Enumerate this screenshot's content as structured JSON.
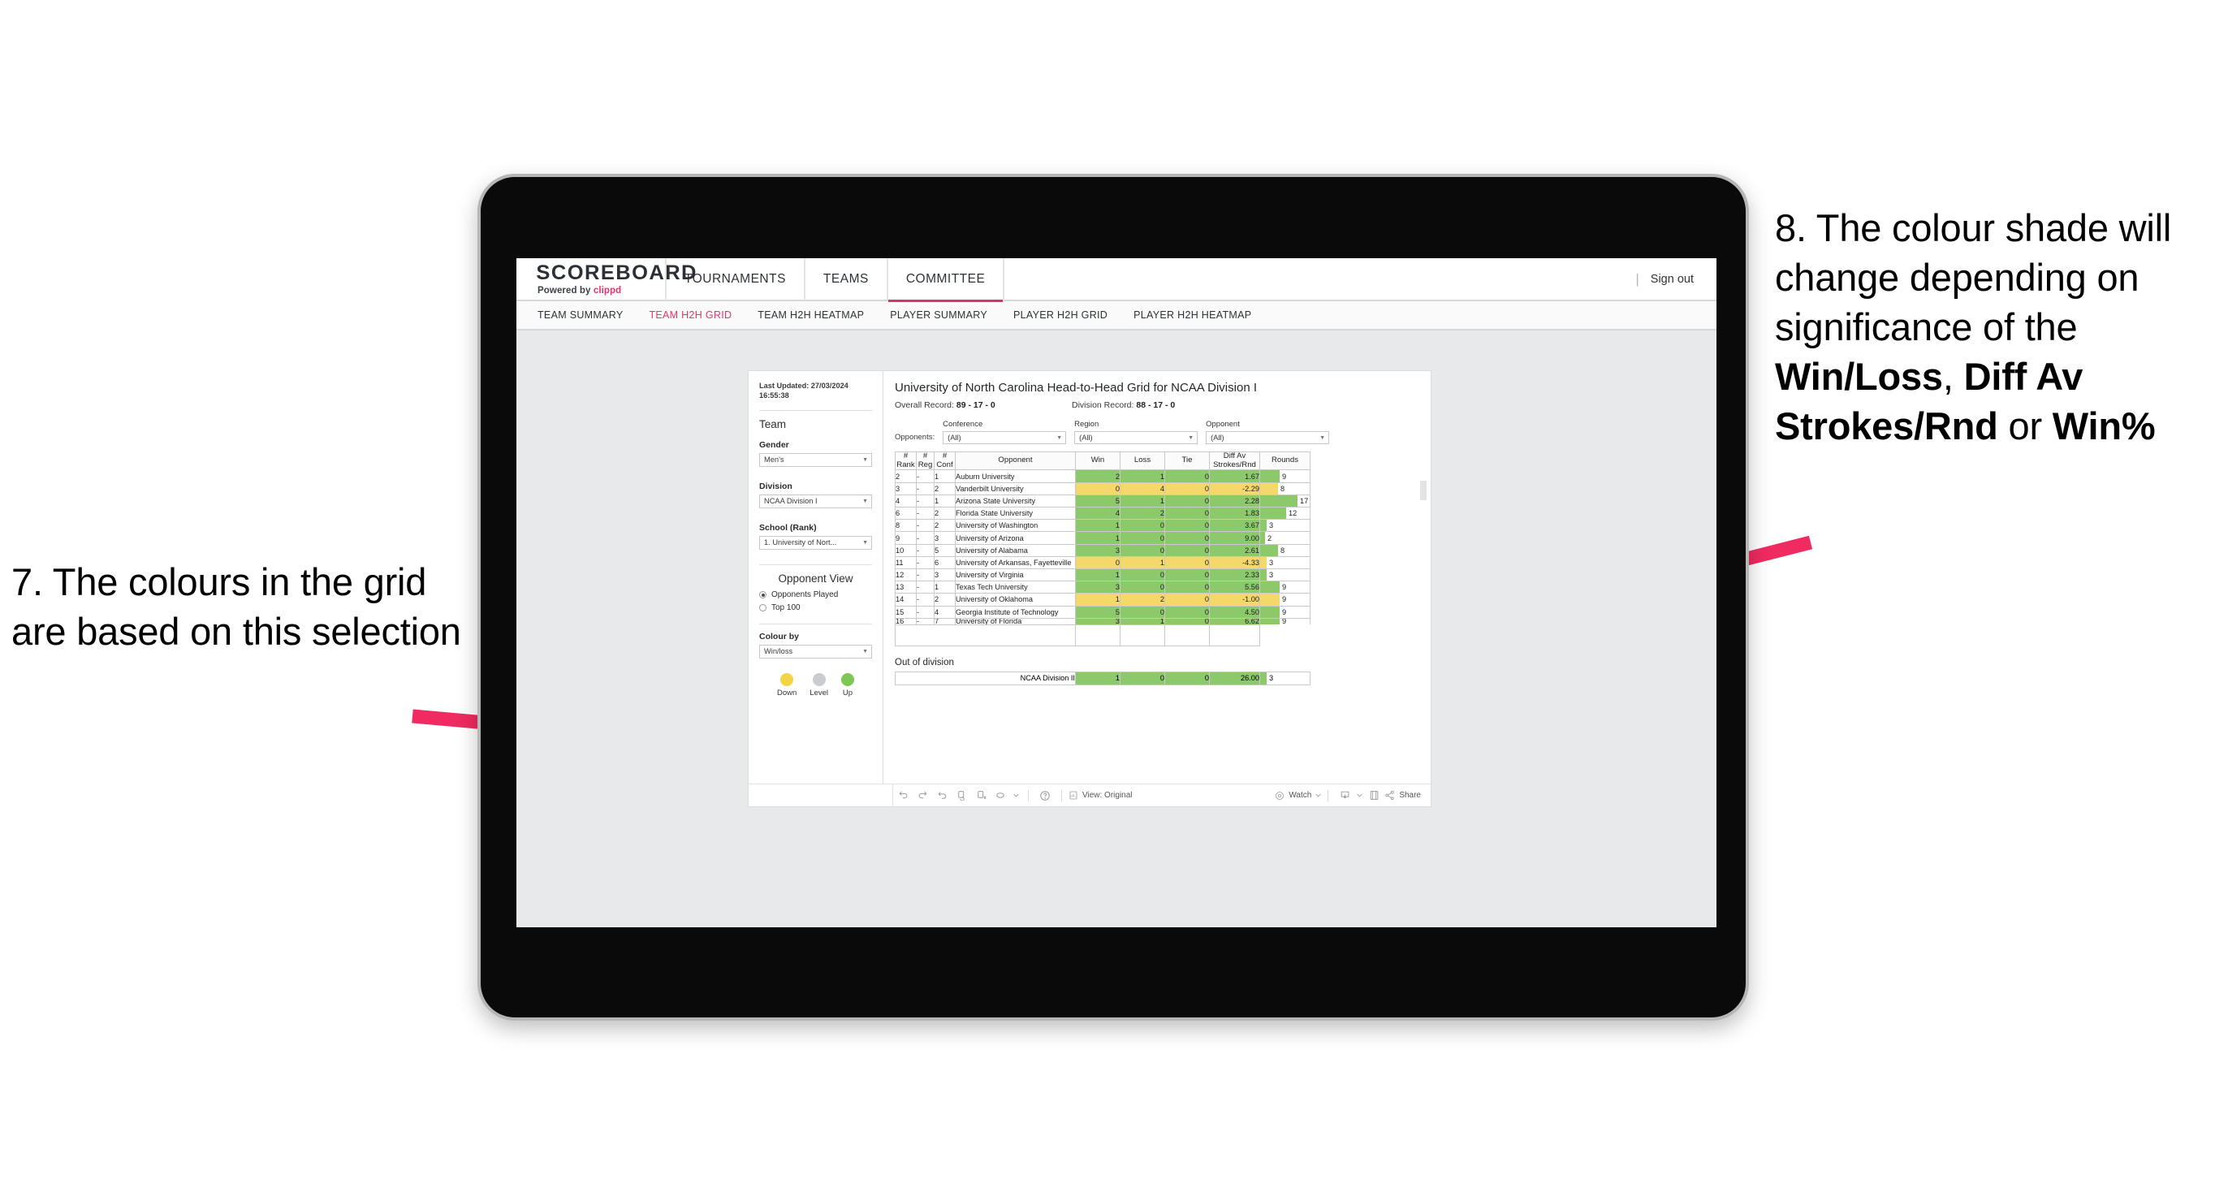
{
  "annotations": {
    "left": {
      "id": "annotation-7",
      "text": "7. The colours in the grid are based on this selection"
    },
    "right": {
      "id": "annotation-8",
      "lead": "8. The colour shade will change depending on significance of the ",
      "bold1": "Win/Loss",
      "mid1": ", ",
      "bold2": "Diff Av Strokes/Rnd",
      "mid2": " or ",
      "bold3": "Win%"
    },
    "arrow_color": "#ef2b61"
  },
  "app": {
    "brand": {
      "title": "SCOREBOARD",
      "powered_prefix": "Powered by ",
      "powered_brand": "clippd"
    },
    "nav": [
      {
        "label": "TOURNAMENTS",
        "active": false
      },
      {
        "label": "TEAMS",
        "active": false
      },
      {
        "label": "COMMITTEE",
        "active": true
      }
    ],
    "nav_divider": "|",
    "sign_out": "Sign out",
    "subnav": [
      {
        "label": "TEAM SUMMARY",
        "active": false
      },
      {
        "label": "TEAM H2H GRID",
        "active": true
      },
      {
        "label": "TEAM H2H HEATMAP",
        "active": false
      },
      {
        "label": "PLAYER SUMMARY",
        "active": false
      },
      {
        "label": "PLAYER H2H GRID",
        "active": false
      },
      {
        "label": "PLAYER H2H HEATMAP",
        "active": false
      }
    ],
    "accent_color": "#e8336a"
  },
  "filters": {
    "last_updated": "Last Updated: 27/03/2024 16:55:38",
    "team_heading": "Team",
    "gender": {
      "label": "Gender",
      "value": "Men's"
    },
    "division": {
      "label": "Division",
      "value": "NCAA Division I"
    },
    "school": {
      "label": "School (Rank)",
      "value": "1. University of Nort..."
    },
    "opponent_view": {
      "heading": "Opponent View",
      "options": [
        {
          "label": "Opponents Played",
          "selected": true
        },
        {
          "label": "Top 100",
          "selected": false
        }
      ]
    },
    "colour_by": {
      "label": "Colour by",
      "value": "Win/loss"
    },
    "legend": [
      {
        "label": "Down",
        "color": "#f5d444"
      },
      {
        "label": "Level",
        "color": "#c9cdd1"
      },
      {
        "label": "Up",
        "color": "#7dc855"
      }
    ]
  },
  "report": {
    "title": "University of North Carolina Head-to-Head Grid for NCAA Division I",
    "overall_record_label": "Overall Record: ",
    "overall_record_value": "89 - 17 - 0",
    "division_record_label": "Division Record: ",
    "division_record_value": "88 - 17 - 0",
    "opponents_label": "Opponents:",
    "opponent_filters": [
      {
        "label": "Conference",
        "value": "(All)"
      },
      {
        "label": "Region",
        "value": "(All)"
      },
      {
        "label": "Opponent",
        "value": "(All)"
      }
    ],
    "out_of_division_title": "Out of division"
  },
  "chart_data": {
    "type": "table",
    "title": "University of North Carolina Head-to-Head Grid for NCAA Division I",
    "columns": [
      "# Rank",
      "# Reg",
      "# Conf",
      "Opponent",
      "Win",
      "Loss",
      "Tie",
      "Diff Av Strokes/Rnd",
      "Rounds"
    ],
    "column_header_lines": [
      [
        "#",
        "Rank"
      ],
      [
        "#",
        "Reg"
      ],
      [
        "#",
        "Conf"
      ],
      [
        "Opponent"
      ],
      [
        "Win"
      ],
      [
        "Loss"
      ],
      [
        "Tie"
      ],
      [
        "Diff Av",
        "Strokes/Rnd"
      ],
      [
        "Rounds"
      ]
    ],
    "colour_by": "Win/loss",
    "colour_scale": {
      "up": "#8cc96a",
      "level": "#c9cdd1",
      "down": "#f5d86a"
    },
    "rounds_max": 17,
    "rows": [
      {
        "rank": "2",
        "reg": "-",
        "conf": "1",
        "opponent": "Auburn University",
        "win": 2,
        "loss": 1,
        "tie": 0,
        "diff": "1.67",
        "rounds": 9,
        "state": "up"
      },
      {
        "rank": "3",
        "reg": "-",
        "conf": "2",
        "opponent": "Vanderbilt University",
        "win": 0,
        "loss": 4,
        "tie": 0,
        "diff": "-2.29",
        "rounds": 8,
        "state": "down"
      },
      {
        "rank": "4",
        "reg": "-",
        "conf": "1",
        "opponent": "Arizona State University",
        "win": 5,
        "loss": 1,
        "tie": 0,
        "diff": "2.28",
        "rounds": 17,
        "state": "up"
      },
      {
        "rank": "6",
        "reg": "-",
        "conf": "2",
        "opponent": "Florida State University",
        "win": 4,
        "loss": 2,
        "tie": 0,
        "diff": "1.83",
        "rounds": 12,
        "state": "up"
      },
      {
        "rank": "8",
        "reg": "-",
        "conf": "2",
        "opponent": "University of Washington",
        "win": 1,
        "loss": 0,
        "tie": 0,
        "diff": "3.67",
        "rounds": 3,
        "state": "up"
      },
      {
        "rank": "9",
        "reg": "-",
        "conf": "3",
        "opponent": "University of Arizona",
        "win": 1,
        "loss": 0,
        "tie": 0,
        "diff": "9.00",
        "rounds": 2,
        "state": "up"
      },
      {
        "rank": "10",
        "reg": "-",
        "conf": "5",
        "opponent": "University of Alabama",
        "win": 3,
        "loss": 0,
        "tie": 0,
        "diff": "2.61",
        "rounds": 8,
        "state": "up"
      },
      {
        "rank": "11",
        "reg": "-",
        "conf": "6",
        "opponent": "University of Arkansas, Fayetteville",
        "win": 0,
        "loss": 1,
        "tie": 0,
        "diff": "-4.33",
        "rounds": 3,
        "state": "down"
      },
      {
        "rank": "12",
        "reg": "-",
        "conf": "3",
        "opponent": "University of Virginia",
        "win": 1,
        "loss": 0,
        "tie": 0,
        "diff": "2.33",
        "rounds": 3,
        "state": "up"
      },
      {
        "rank": "13",
        "reg": "-",
        "conf": "1",
        "opponent": "Texas Tech University",
        "win": 3,
        "loss": 0,
        "tie": 0,
        "diff": "5.56",
        "rounds": 9,
        "state": "up"
      },
      {
        "rank": "14",
        "reg": "-",
        "conf": "2",
        "opponent": "University of Oklahoma",
        "win": 1,
        "loss": 2,
        "tie": 0,
        "diff": "-1.00",
        "rounds": 9,
        "state": "down"
      },
      {
        "rank": "15",
        "reg": "-",
        "conf": "4",
        "opponent": "Georgia Institute of Technology",
        "win": 5,
        "loss": 0,
        "tie": 0,
        "diff": "4.50",
        "rounds": 9,
        "state": "up"
      },
      {
        "rank": "16",
        "reg": "-",
        "conf": "7",
        "opponent": "University of Florida",
        "win": 3,
        "loss": 1,
        "tie": 0,
        "diff": "6.62",
        "rounds": 9,
        "state": "up"
      }
    ],
    "out_of_division_rows": [
      {
        "opponent": "NCAA Division II",
        "win": 1,
        "loss": 0,
        "tie": 0,
        "diff": "26.00",
        "rounds": 3,
        "state": "up"
      }
    ]
  },
  "toolbar": {
    "view_label": "View: Original",
    "watch_label": "Watch",
    "share_label": "Share"
  }
}
